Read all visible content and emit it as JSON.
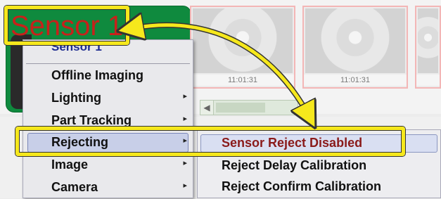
{
  "thumbnails": [
    {
      "time": "11:01:31"
    },
    {
      "time": "11:01:31"
    },
    {
      "time": ""
    }
  ],
  "callout": {
    "label": "Sensor 1",
    "color": "#c8211b",
    "highlight_color": "#f6e81c"
  },
  "context_menu": {
    "header": "Sensor 1",
    "items": [
      {
        "label": "Offline Imaging",
        "submenu": false
      },
      {
        "label": "Lighting",
        "submenu": true
      },
      {
        "label": "Part Tracking",
        "submenu": true
      },
      {
        "label": "Rejecting",
        "submenu": true,
        "selected": true
      },
      {
        "label": "Image",
        "submenu": true
      },
      {
        "label": "Camera",
        "submenu": true
      }
    ]
  },
  "submenu": {
    "items": [
      {
        "label": "Sensor Reject Disabled",
        "active": true
      },
      {
        "label": "Reject Delay Calibration"
      },
      {
        "label": "Reject Confirm Calibration"
      }
    ]
  },
  "icons": {
    "submenu_arrow": "▸",
    "scroll_left": "◀"
  }
}
